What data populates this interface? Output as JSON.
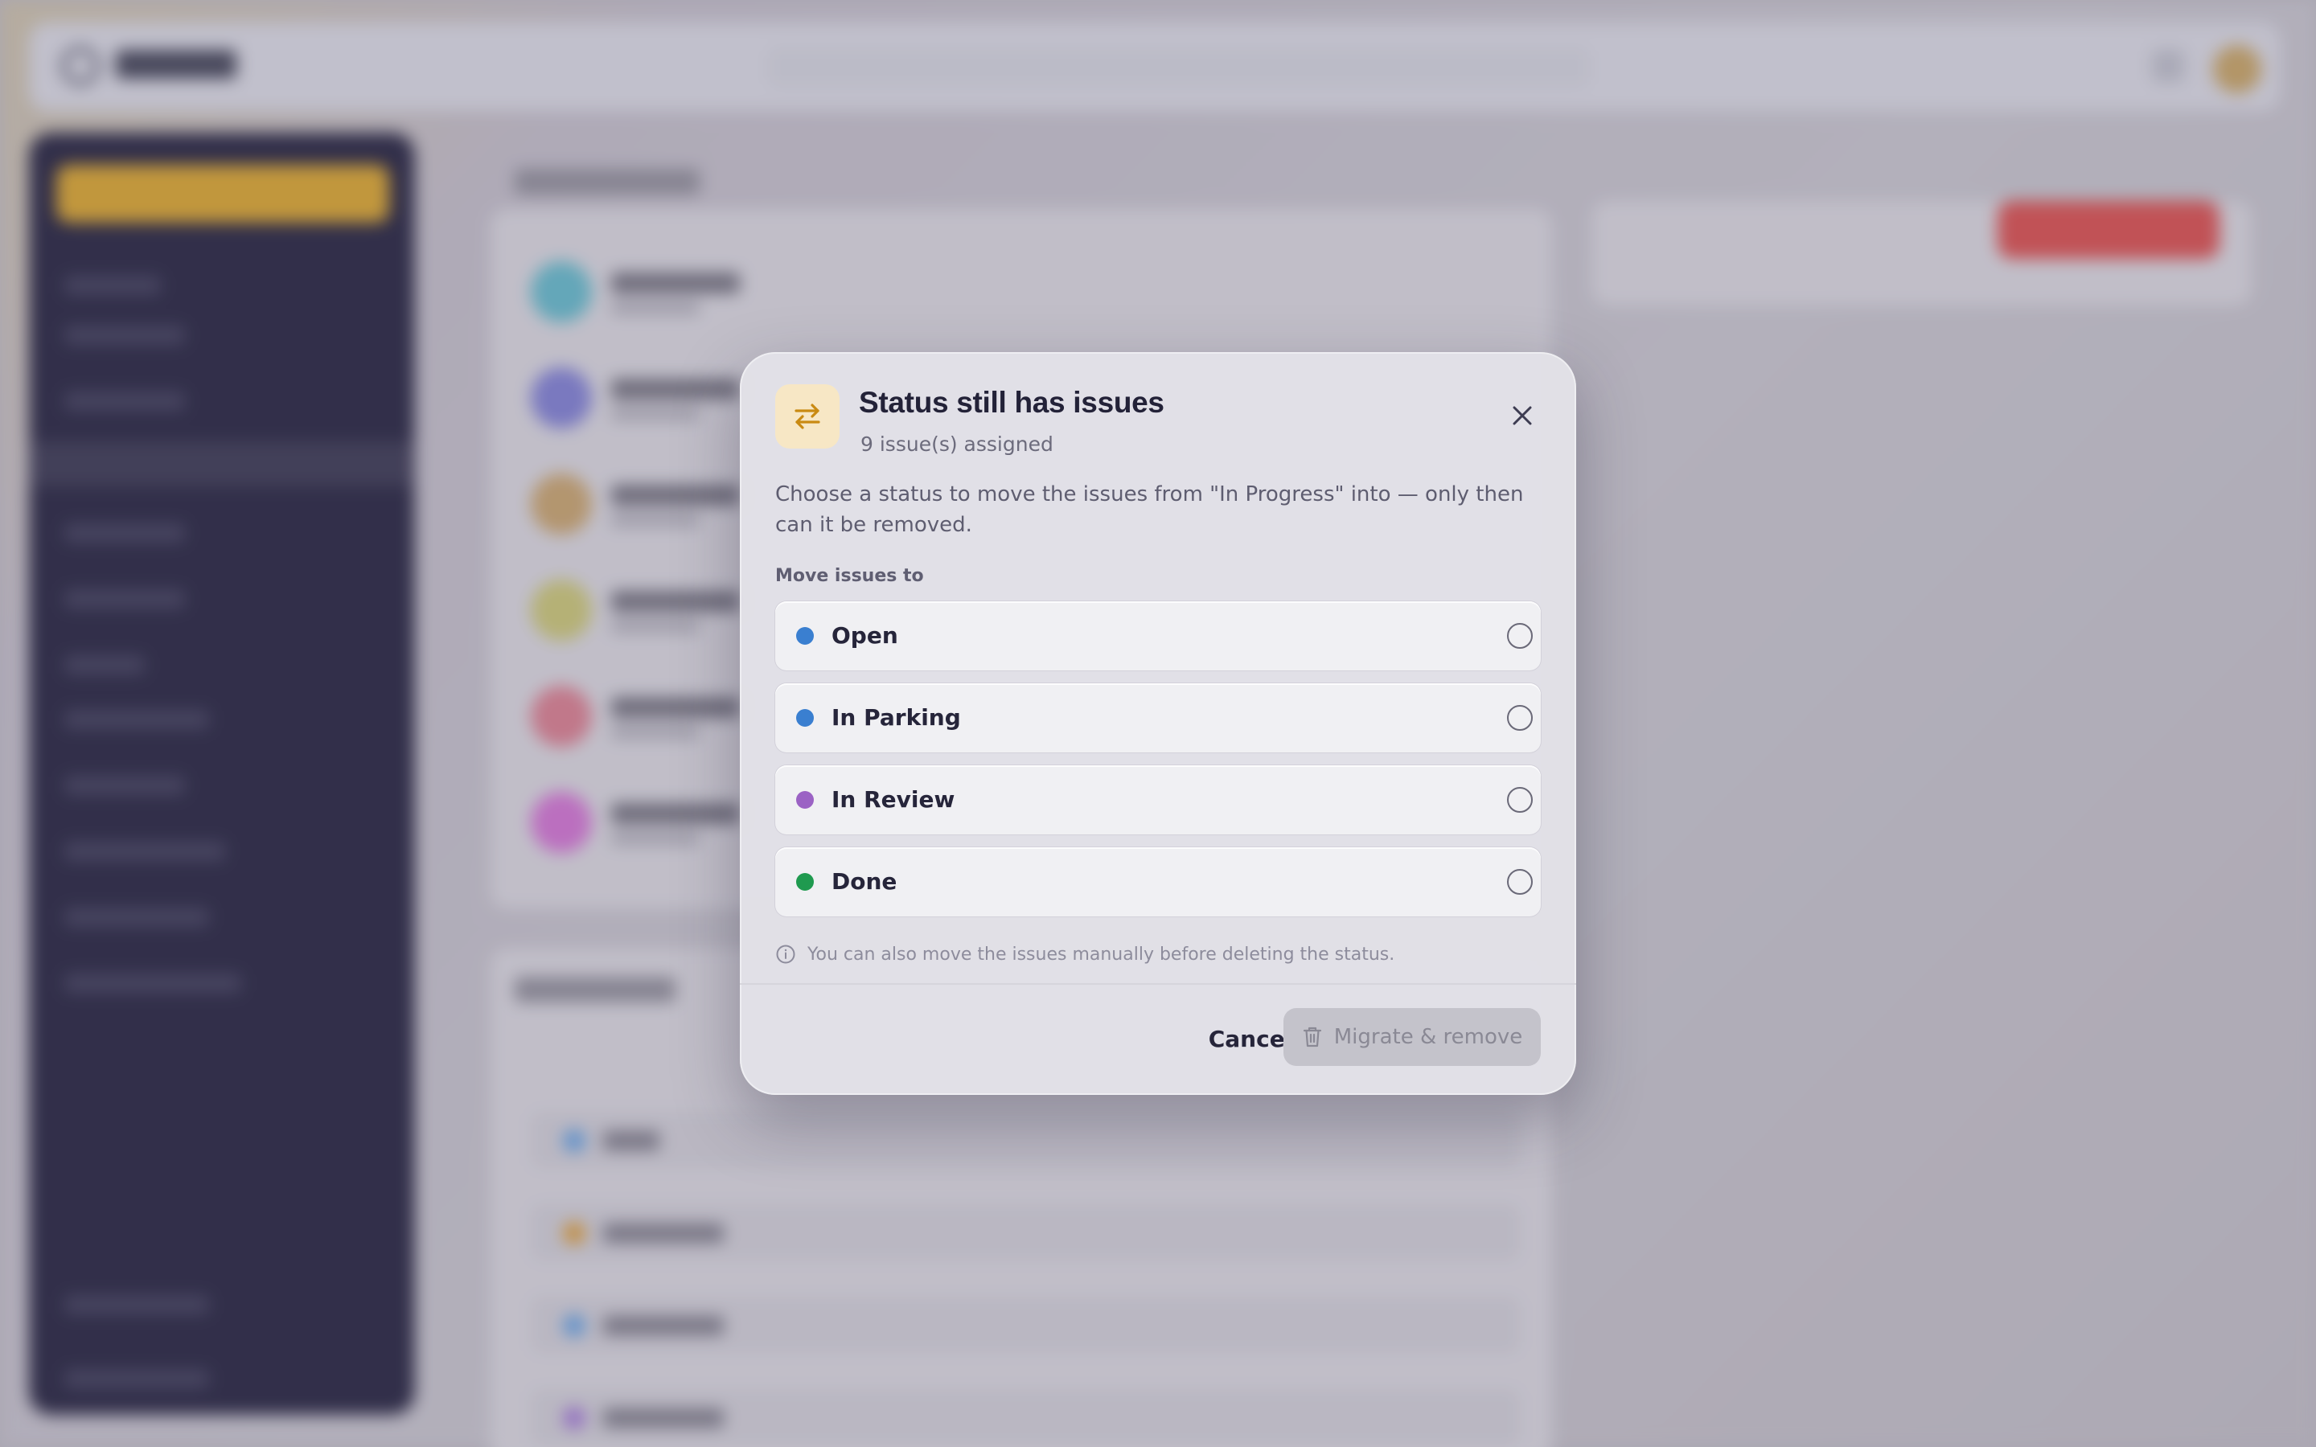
{
  "dialog": {
    "title": "Status still has issues",
    "subtitle": "9 issue(s) assigned",
    "description": "Choose a status to move the issues from \"In Progress\" into — only then can it be removed.",
    "section_label": "Move issues to",
    "options": [
      {
        "label": "Open",
        "color": "#3a7fd0",
        "selected": false
      },
      {
        "label": "In Parking",
        "color": "#3a7fd0",
        "selected": false
      },
      {
        "label": "In Review",
        "color": "#9b62c4",
        "selected": false
      },
      {
        "label": "Done",
        "color": "#1f9a4f",
        "selected": false
      }
    ],
    "hint": "You can also move the issues manually before deleting the status.",
    "cancel_label": "Cancel",
    "migrate_label": "Migrate & remove",
    "migrate_disabled": true,
    "icons": {
      "header": "swap-arrows-icon",
      "close": "close-icon",
      "hint": "info-icon",
      "migrate": "trash-icon"
    },
    "accent_color": "#c98a12"
  }
}
